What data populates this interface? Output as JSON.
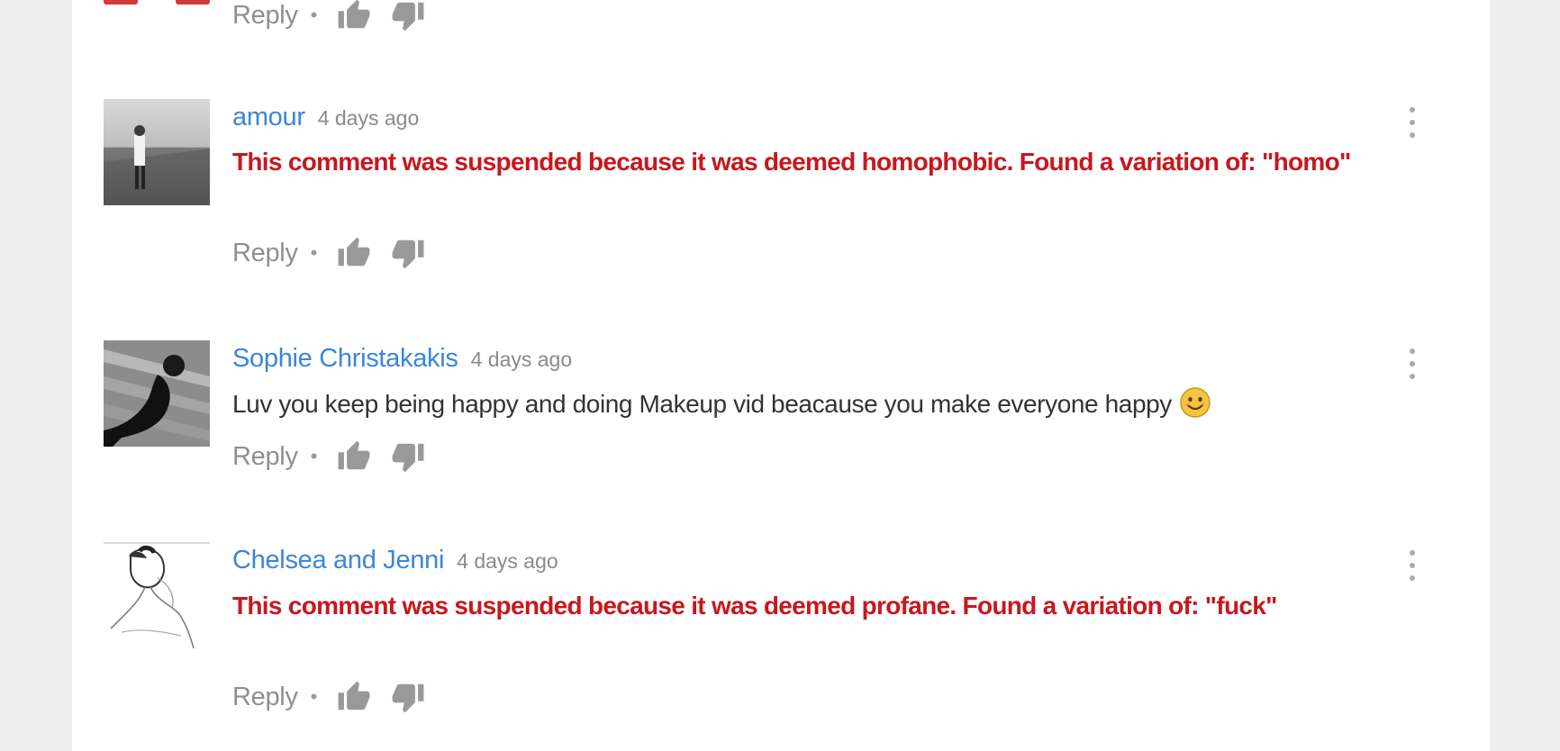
{
  "icons": {
    "like": "thumbs-up-icon",
    "dislike": "thumbs-down-icon",
    "menu": "kebab-menu-icon",
    "emoji": "smiling-face-emoji"
  },
  "colors": {
    "author": "#3b86d8",
    "suspended_text": "#c8171e",
    "muted": "#8f8f8f",
    "page_background": "#eeeeee",
    "panel_background": "#ffffff"
  },
  "top_actions": {
    "reply_label": "Reply",
    "separator": "•"
  },
  "comments": [
    {
      "author": "amour",
      "time": "4 days ago",
      "status": "suspended",
      "text": "This comment was suspended because it was deemed homophobic. Found a variation of: \"homo\"",
      "reply_label": "Reply",
      "separator": "•"
    },
    {
      "author": "Sophie Christakakis",
      "time": "4 days ago",
      "status": "normal",
      "text": "Luv you keep being happy and doing Makeup vid beacause you make everyone happy",
      "reply_label": "Reply",
      "separator": "•"
    },
    {
      "author": "Chelsea and Jenni",
      "time": "4 days ago",
      "status": "suspended",
      "text": "This comment was suspended because it was deemed profane. Found a variation of: \"fuck\"",
      "reply_label": "Reply",
      "separator": "•"
    }
  ]
}
